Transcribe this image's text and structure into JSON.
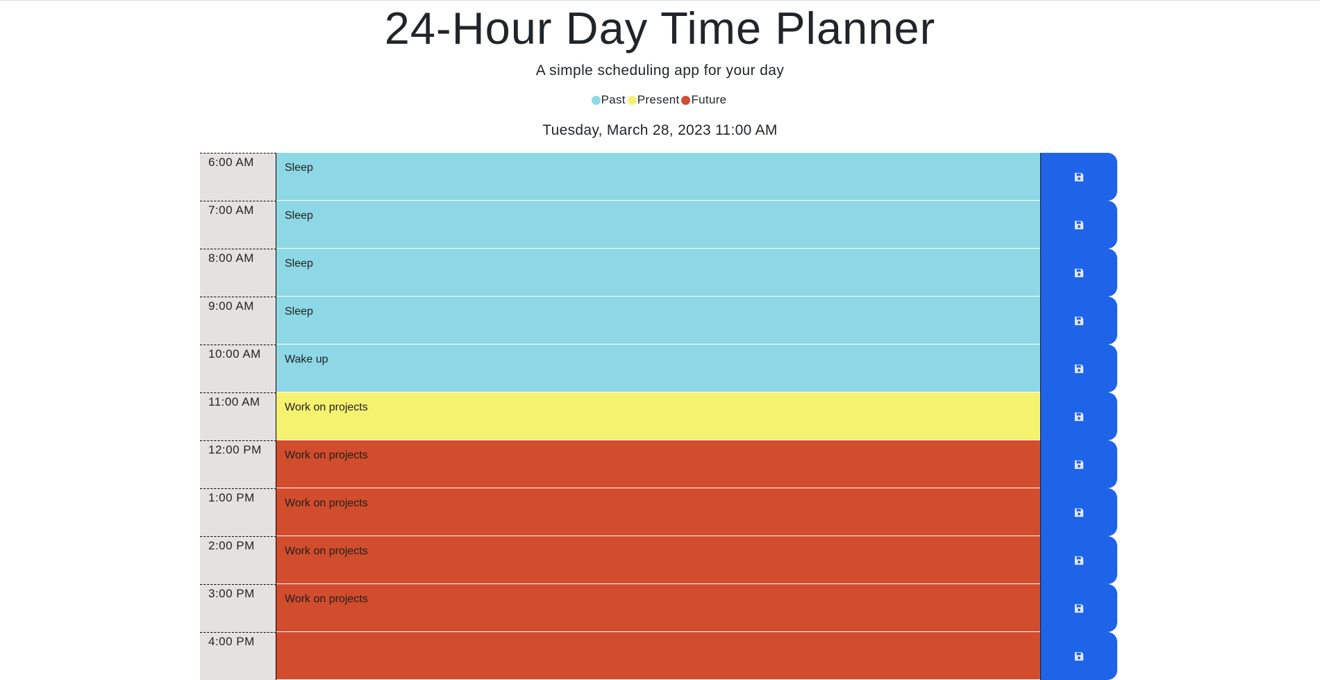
{
  "header": {
    "title": "24-Hour Day Time Planner",
    "subtitle": "A simple scheduling app for your day",
    "current_datetime": "Tuesday, March 28, 2023 11:00 AM"
  },
  "legend": [
    {
      "label": "Past",
      "color": "#8ed8e5"
    },
    {
      "label": "Present",
      "color": "#f5f270"
    },
    {
      "label": "Future",
      "color": "#d14d2d"
    }
  ],
  "colors": {
    "past": "#8ed8e5",
    "present": "#f5f270",
    "future": "#d14d2d",
    "save_button": "#1f63e9",
    "hour_cell": "#e6e1e1"
  },
  "save_icon": "floppy-disk-icon",
  "time_blocks": [
    {
      "hour": "6:00 AM",
      "description": "Sleep",
      "status": "past"
    },
    {
      "hour": "7:00 AM",
      "description": "Sleep",
      "status": "past"
    },
    {
      "hour": "8:00 AM",
      "description": "Sleep",
      "status": "past"
    },
    {
      "hour": "9:00 AM",
      "description": "Sleep",
      "status": "past"
    },
    {
      "hour": "10:00 AM",
      "description": "Wake up",
      "status": "past"
    },
    {
      "hour": "11:00 AM",
      "description": "Work on projects",
      "status": "present"
    },
    {
      "hour": "12:00 PM",
      "description": "Work on projects",
      "status": "future"
    },
    {
      "hour": "1:00 PM",
      "description": "Work on projects",
      "status": "future"
    },
    {
      "hour": "2:00 PM",
      "description": "Work on projects",
      "status": "future"
    },
    {
      "hour": "3:00 PM",
      "description": "Work on projects",
      "status": "future"
    },
    {
      "hour": "4:00 PM",
      "description": "",
      "status": "future"
    }
  ]
}
